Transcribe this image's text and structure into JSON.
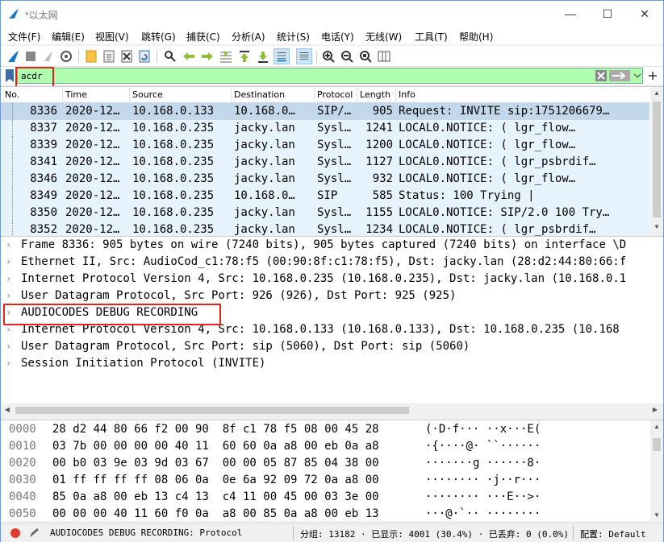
{
  "window": {
    "title": "*以太网",
    "minimize": "—",
    "maximize": "☐",
    "close": "✕"
  },
  "menu": [
    "文件(F)",
    "编辑(E)",
    "视图(V)",
    "跳转(G)",
    "捕获(C)",
    "分析(A)",
    "统计(S)",
    "电话(Y)",
    "无线(W)",
    "工具(T)",
    "帮助(H)"
  ],
  "filter": {
    "value": "acdr"
  },
  "columns": [
    "No.",
    "Time",
    "Source",
    "Destination",
    "Protocol",
    "Length",
    "Info"
  ],
  "packets": [
    {
      "no": "8336",
      "time": "2020-12…",
      "src": "10.168.0.133",
      "dst": "10.168.0…",
      "proto": "SIP/…",
      "len": "905",
      "info": "Request: INVITE sip:1751206679…",
      "selected": true
    },
    {
      "no": "8337",
      "time": "2020-12…",
      "src": "10.168.0.235",
      "dst": "jacky.lan",
      "proto": "Sysl…",
      "len": "1241",
      "info": "LOCAL0.NOTICE: (      lgr_flow…"
    },
    {
      "no": "8339",
      "time": "2020-12…",
      "src": "10.168.0.235",
      "dst": "jacky.lan",
      "proto": "Sysl…",
      "len": "1200",
      "info": "LOCAL0.NOTICE: (      lgr_flow…"
    },
    {
      "no": "8341",
      "time": "2020-12…",
      "src": "10.168.0.235",
      "dst": "jacky.lan",
      "proto": "Sysl…",
      "len": "1127",
      "info": "LOCAL0.NOTICE: (    lgr_psbrdif…"
    },
    {
      "no": "8346",
      "time": "2020-12…",
      "src": "10.168.0.235",
      "dst": "jacky.lan",
      "proto": "Sysl…",
      "len": "932",
      "info": "LOCAL0.NOTICE: (      lgr_flow…"
    },
    {
      "no": "8349",
      "time": "2020-12…",
      "src": "10.168.0.235",
      "dst": "10.168.0…",
      "proto": "SIP",
      "len": "585",
      "info": "Status: 100 Trying |"
    },
    {
      "no": "8350",
      "time": "2020-12…",
      "src": "10.168.0.235",
      "dst": "jacky.lan",
      "proto": "Sysl…",
      "len": "1155",
      "info": "LOCAL0.NOTICE: SIP/2.0 100 Try…"
    },
    {
      "no": "8352",
      "time": "2020-12…",
      "src": "10.168.0.235",
      "dst": "jacky.lan",
      "proto": "Sysl…",
      "len": "1234",
      "info": "LOCAL0.NOTICE: (    lgr_psbrdif…"
    }
  ],
  "details": [
    "Frame 8336: 905 bytes on wire (7240 bits), 905 bytes captured (7240 bits) on interface \\D",
    "Ethernet II, Src: AudioCod_c1:78:f5 (00:90:8f:c1:78:f5), Dst: jacky.lan (28:d2:44:80:66:f",
    "Internet Protocol Version 4, Src: 10.168.0.235 (10.168.0.235), Dst: jacky.lan (10.168.0.1",
    "User Datagram Protocol, Src Port: 926 (926), Dst Port: 925 (925)",
    "AUDIOCODES DEBUG RECORDING",
    "Internet Protocol Version 4, Src: 10.168.0.133 (10.168.0.133), Dst: 10.168.0.235 (10.168",
    "User Datagram Protocol, Src Port: sip (5060), Dst Port: sip (5060)",
    "Session Initiation Protocol (INVITE)"
  ],
  "hex": [
    {
      "offset": "0000",
      "bytes": "28 d2 44 80 66 f2 00 90  8f c1 78 f5 08 00 45 28",
      "ascii": "(·D·f··· ··x···E("
    },
    {
      "offset": "0010",
      "bytes": "03 7b 00 00 00 00 40 11  60 60 0a a8 00 eb 0a a8",
      "ascii": "·{····@· ``······"
    },
    {
      "offset": "0020",
      "bytes": "00 b0 03 9e 03 9d 03 67  00 00 05 87 85 04 38 00",
      "ascii": "·······g ······8·"
    },
    {
      "offset": "0030",
      "bytes": "01 ff ff ff ff 08 06 0a  0e 6a 92 09 72 0a a8 00",
      "ascii": "········ ·j··r···"
    },
    {
      "offset": "0040",
      "bytes": "85 0a a8 00 eb 13 c4 13  c4 11 00 45 00 03 3e 00",
      "ascii": "········ ···E··>·"
    },
    {
      "offset": "0050",
      "bytes": "00 00 00 40 11 60 f0 0a  a8 00 85 0a a8 00 eb 13",
      "ascii": "···@·`·· ········"
    }
  ],
  "status": {
    "field": "AUDIOCODES DEBUG RECORDING: Protocol",
    "stats": "分组: 13182 · 已显示: 4001 (30.4%) · 已丢弃: 0 (0.0%)",
    "profile": "配置: Default"
  },
  "colors": {
    "filter_valid": "#afffaf",
    "row_bg": "#e6f2fc",
    "row_selected": "#c4d8ec",
    "highlight": "#e1241c"
  }
}
